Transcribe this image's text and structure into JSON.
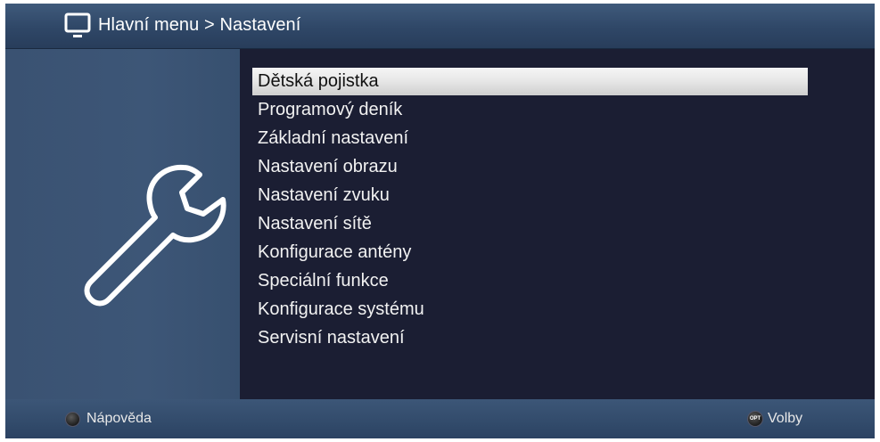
{
  "header": {
    "breadcrumb": "Hlavní menu > Nastavení",
    "icon": "tv-icon"
  },
  "sidebar": {
    "icon": "wrench-icon"
  },
  "menu": {
    "selected_index": 0,
    "items": [
      "Dětská pojistka",
      "Programový deník",
      "Základní nastavení",
      "Nastavení obrazu",
      "Nastavení zvuku",
      "Nastavení sítě",
      "Konfigurace antény",
      "Speciální funkce",
      "Konfigurace systému",
      "Servisní nastavení"
    ]
  },
  "footer": {
    "help_label": "Nápověda",
    "options_label": "Volby",
    "options_key": "OPT"
  },
  "colors": {
    "background": "#1b1e33",
    "header": "#2f4767",
    "panel": "#3d5677",
    "selection": "#e6e6e6"
  }
}
